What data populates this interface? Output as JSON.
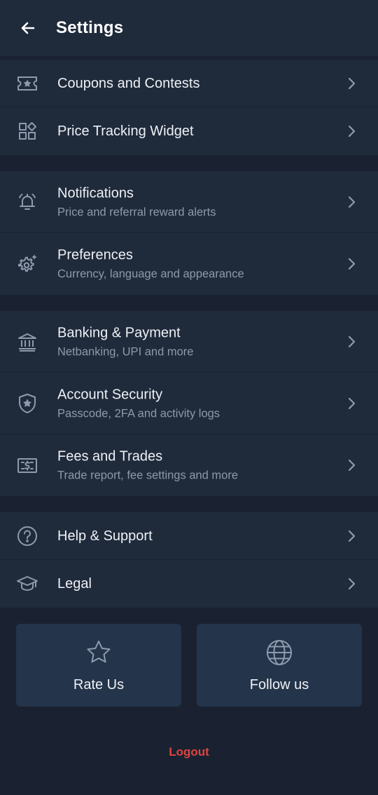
{
  "header": {
    "title": "Settings",
    "back_icon": "arrow-left-icon"
  },
  "groups": [
    {
      "items": [
        {
          "title": "Coupons and Contests",
          "icon": "ticket-star-icon"
        },
        {
          "title": "Price Tracking Widget",
          "icon": "widget-grid-icon"
        }
      ]
    },
    {
      "items": [
        {
          "title": "Notifications",
          "subtitle": "Price and referral reward alerts",
          "icon": "bell-icon"
        },
        {
          "title": "Preferences",
          "subtitle": "Currency, language and appearance",
          "icon": "gear-sparkle-icon"
        }
      ]
    },
    {
      "items": [
        {
          "title": "Banking & Payment",
          "subtitle": "Netbanking, UPI and more",
          "icon": "bank-icon"
        },
        {
          "title": "Account Security",
          "subtitle": "Passcode, 2FA and activity logs",
          "icon": "shield-star-icon"
        },
        {
          "title": "Fees and Trades",
          "subtitle": "Trade report, fee settings and more",
          "icon": "money-bill-icon"
        }
      ]
    },
    {
      "items": [
        {
          "title": "Help & Support",
          "icon": "question-circle-icon"
        },
        {
          "title": "Legal",
          "icon": "graduation-cap-icon"
        }
      ]
    }
  ],
  "cards": [
    {
      "label": "Rate Us",
      "icon": "star-icon"
    },
    {
      "label": "Follow us",
      "icon": "globe-icon"
    }
  ],
  "logout": {
    "label": "Logout"
  },
  "colors": {
    "background": "#1a2231",
    "surface": "#1f2a3b",
    "card": "#24344a",
    "icon": "#8f9bad",
    "subtitle": "#8e9aab",
    "logout": "#e0443e"
  }
}
